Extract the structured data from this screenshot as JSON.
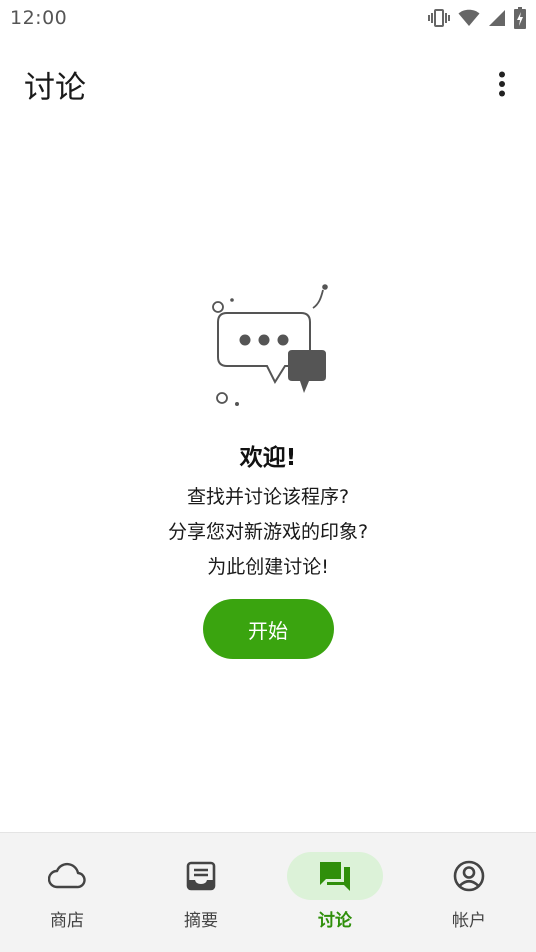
{
  "status_bar": {
    "time": "12:00",
    "icons": [
      "vibrate-icon",
      "wifi-icon",
      "signal-icon",
      "battery-icon"
    ]
  },
  "app_bar": {
    "title": "讨论",
    "overflow_icon": "more-vert-icon"
  },
  "empty_state": {
    "illustration": "chat-bubbles-illustration",
    "title": "欢迎!",
    "lines": [
      "查找并讨论该程序?",
      "分享您对新游戏的印象?",
      "为此创建讨论!"
    ],
    "button_label": "开始"
  },
  "bottom_nav": {
    "items": [
      {
        "label": "商店",
        "icon": "cloud-icon",
        "active": false
      },
      {
        "label": "摘要",
        "icon": "inbox-icon",
        "active": false
      },
      {
        "label": "讨论",
        "icon": "forum-icon",
        "active": true
      },
      {
        "label": "帐户",
        "icon": "account-icon",
        "active": false
      }
    ]
  },
  "colors": {
    "accent": "#3aa40f",
    "active_nav_bg": "#dcf2d8",
    "active_nav_text": "#2f8f0a",
    "nav_bg": "#f3f3f3"
  }
}
